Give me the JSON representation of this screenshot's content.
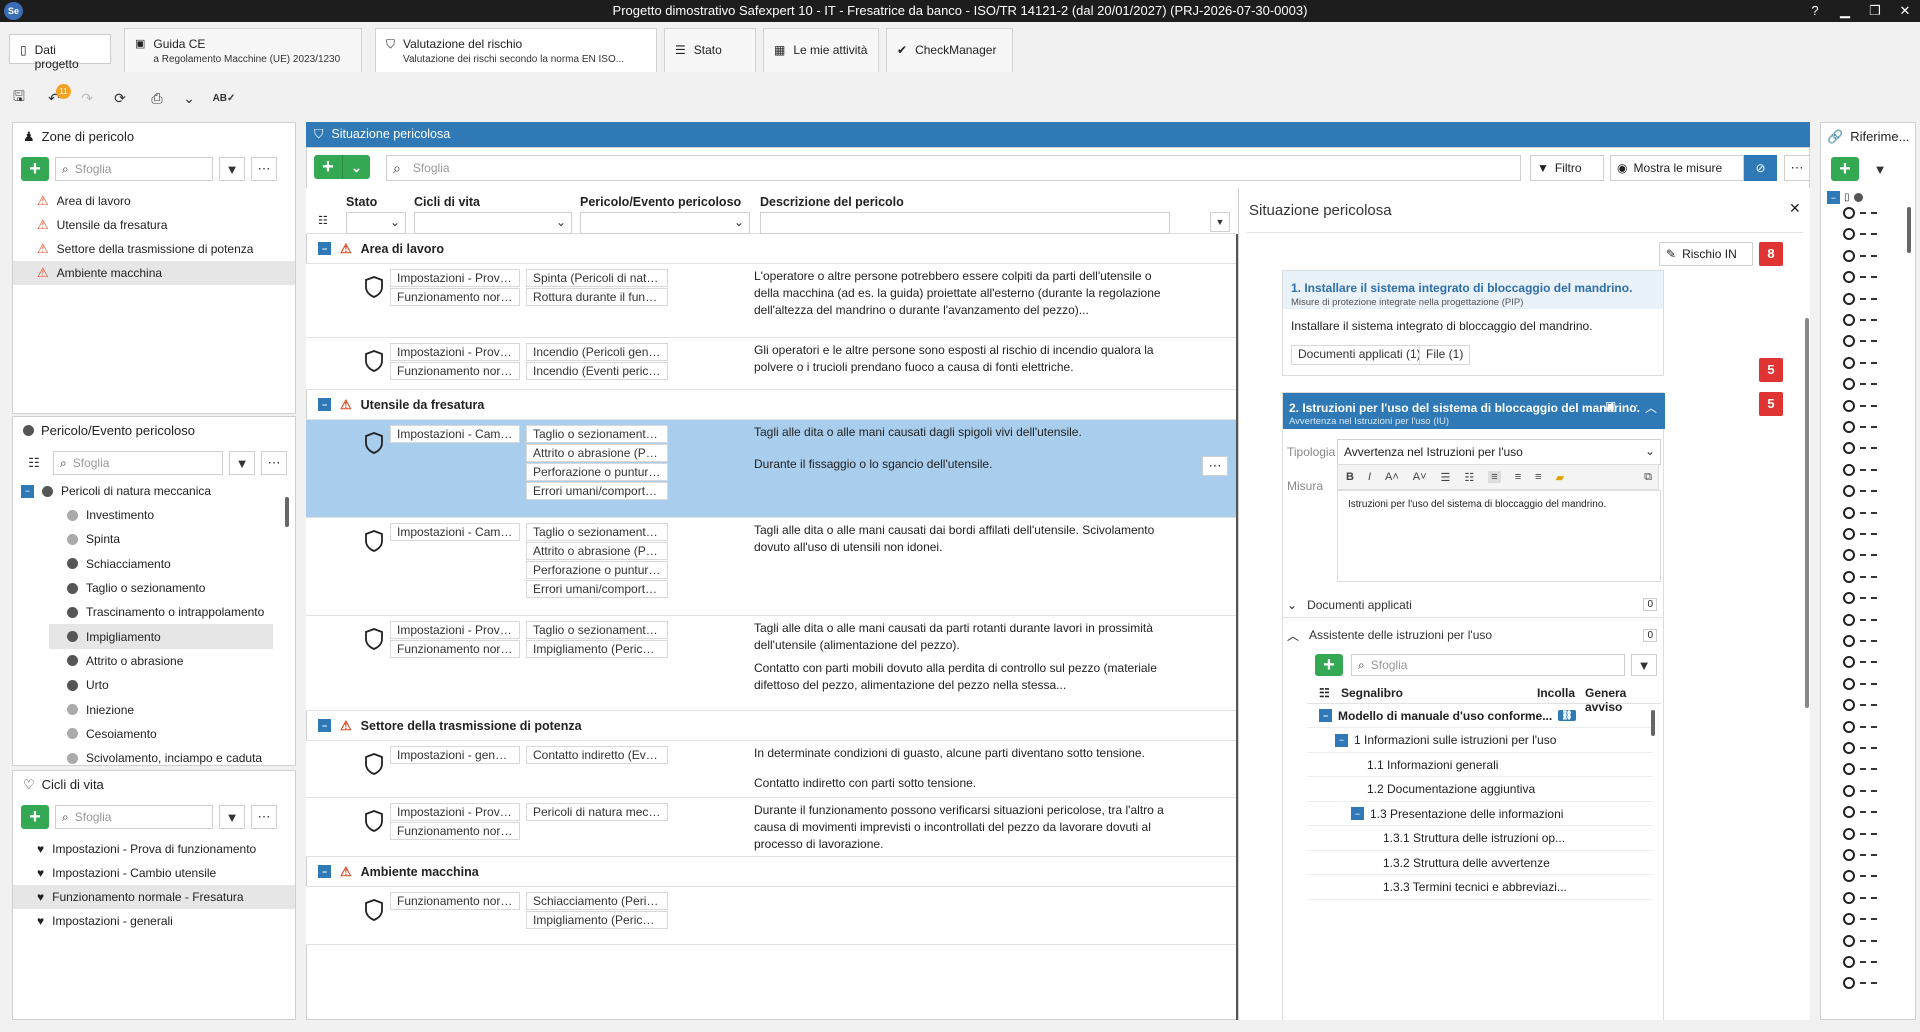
{
  "window": {
    "title": "Progetto dimostrativo Safexpert 10 - IT - Fresatrice da banco - ISO/TR 14121-2 (dal 20/01/2027) (PRJ-2026-07-30-0003)",
    "logo": "Se",
    "help": "?"
  },
  "tabs": {
    "dati": "Dati progetto",
    "guida_title": "Guida CE",
    "guida_sub": "a Regolamento Macchine (UE) 2023/1230",
    "val_title": "Valutazione del rischio",
    "val_sub": "Valutazione dei rischi secondo la norma EN ISO...",
    "stato": "Stato",
    "attivita": "Le mie attività",
    "check": "CheckManager"
  },
  "toolbar": {
    "undo_badge": "11"
  },
  "zones": {
    "title": "Zone di pericolo",
    "search": "Sfoglia",
    "items": [
      "Area di lavoro",
      "Utensile da fresatura",
      "Settore della trasmissione di potenza",
      "Ambiente macchina"
    ]
  },
  "hazards": {
    "title": "Pericolo/Evento pericoloso",
    "search": "Sfoglia",
    "root": "Pericoli di natura meccanica",
    "items": [
      "Investimento",
      "Spinta",
      "Schiacciamento",
      "Taglio o sezionamento",
      "Trascinamento o intrappolamento",
      "Impigliamento",
      "Attrito o abrasione",
      "Urto",
      "Iniezione",
      "Cesoiamento",
      "Scivolamento, inciampo e caduta"
    ]
  },
  "lifecycles": {
    "title": "Cicli di vita",
    "search": "Sfoglia",
    "items": [
      "Impostazioni - Prova di funzionamento",
      "Impostazioni - Cambio utensile",
      "Funzionamento normale - Fresatura",
      "Impostazioni - generali"
    ]
  },
  "main": {
    "title": "Situazione pericolosa",
    "search": "Sfoglia",
    "filter": "Filtro",
    "show": "Mostra le misure",
    "cols": {
      "stato": "Stato",
      "cicli": "Cicli di vita",
      "pericolo": "Pericolo/Evento pericoloso",
      "descr": "Descrizione del pericolo"
    },
    "groups": [
      "Area di lavoro",
      "Utensile da fresatura",
      "Settore della trasmissione di potenza",
      "Ambiente macchina"
    ],
    "rows": [
      {
        "c": [
          "Impostazioni - Prova di f...",
          "Funzionamento normale..."
        ],
        "p": [
          "Spinta (Pericoli di natura m...",
          "Rottura durante il funziona..."
        ],
        "d": "L'operatore o altre persone potrebbero essere colpiti da parti dell'utensile o della macchina (ad es. la guida) proiettate all'esterno (durante la regolazione dell'altezza del mandrino o durante l'avanzamento del pezzo)..."
      },
      {
        "c": [
          "Impostazioni - Prova di f...",
          "Funzionamento normale..."
        ],
        "p": [
          "Incendio (Pericoli generati...",
          "Incendio (Eventi pericolosi..."
        ],
        "d": "Gli operatori e le altre persone sono esposti al rischio di incendio qualora la polvere o i trucioli prendano fuoco a causa di fonti elettriche."
      },
      {
        "c": [
          "Impostazioni - Cambio u..."
        ],
        "p": [
          "Taglio o sezionamento (Per...",
          "Attrito o abrasione (Pericol...",
          "Perforazione o puntura (Pe...",
          "Errori umani/comportame..."
        ],
        "d": "Tagli alle dita o alle mani causati dagli spigoli vivi dell'utensile.",
        "d2": "Durante il fissaggio o lo sgancio dell'utensile."
      },
      {
        "c": [
          "Impostazioni - Cambio u..."
        ],
        "p": [
          "Taglio o sezionamento (Per...",
          "Attrito o abrasione (Pericol...",
          "Perforazione o puntura (Pe...",
          "Errori umani/comportame..."
        ],
        "d": "Tagli alle dita o alle mani causati dai bordi affilati dell'utensile. Scivolamento dovuto all'uso di utensili non idonei."
      },
      {
        "c": [
          "Impostazioni - Prova di f...",
          "Funzionamento normale..."
        ],
        "p": [
          "Taglio o sezionamento (Per...",
          "Impigliamento (Pericoli di..."
        ],
        "d": "Tagli alle dita o alle mani causati da parti rotanti durante lavori in prossimità dell'utensile (alimentazione del pezzo).",
        "d2": "Contatto con parti mobili dovuto alla perdita di controllo sul pezzo (materiale difettoso del pezzo, alimentazione del pezzo nella stessa..."
      },
      {
        "c": [
          "Impostazioni - generali"
        ],
        "p": [
          "Contatto indiretto (Eventi..."
        ],
        "d": "In determinate condizioni di guasto, alcune parti diventano sotto tensione.",
        "d2": "Contatto indiretto con parti sotto tensione."
      },
      {
        "c": [
          "Impostazioni - Prova di f...",
          "Funzionamento normale..."
        ],
        "p": [
          "Pericoli di natura meccanica"
        ],
        "d": "Durante il funzionamento possono verificarsi situazioni pericolose, tra l'altro a causa di movimenti imprevisti o incontrollati del pezzo da lavorare dovuti al processo di lavorazione."
      },
      {
        "c": [
          "Funzionamento normale..."
        ],
        "p": [
          "Schiacciamento (Pericoli di...",
          "Impigliamento (Pericoli di..."
        ],
        "d": ""
      }
    ]
  },
  "detail": {
    "title": "Situazione pericolosa",
    "rischio": "Rischio IN",
    "rischio_val": "8",
    "m1": {
      "title": "1. Installare il sistema integrato di bloccaggio del mandrino.",
      "sub": "Misure di protezione integrate nella progettazione (PIP)",
      "body": "Installare il sistema integrato di bloccaggio del mandrino.",
      "doc": "Documenti applicati (1)",
      "file": "File (1)",
      "val": "5"
    },
    "m2": {
      "title": "2. Istruzioni per l'uso del sistema di bloccaggio del mandrino.",
      "sub": "Avvertenza nel Istruzioni per l'uso (IU)",
      "val": "5",
      "tip_label": "Tipologia",
      "tip_value": "Avvertenza nel Istruzioni per l'uso",
      "mis_label": "Misura",
      "editor_text": "Istruzioni per l'uso del sistema di bloccaggio del mandrino."
    },
    "docs": "Documenti applicati",
    "docs_n": "0",
    "assist": "Assistente delle istruzioni per l'uso",
    "assist_n": "0",
    "search": "Sfoglia",
    "acols": {
      "a": "Segnalibro",
      "b": "Incolla",
      "c": "Genera avviso"
    },
    "tree": [
      "Modello di manuale d'uso conforme...",
      "1 Informazioni sulle istruzioni per l'uso",
      "1.1 Informazioni generali",
      "1.2 Documentazione aggiuntiva",
      "1.3 Presentazione delle informazioni",
      "1.3.1 Struttura delle istruzioni op...",
      "1.3.2 Struttura delle avvertenze",
      "1.3.3 Termini tecnici e abbreviazi..."
    ]
  },
  "refs": {
    "title": "Riferime..."
  }
}
